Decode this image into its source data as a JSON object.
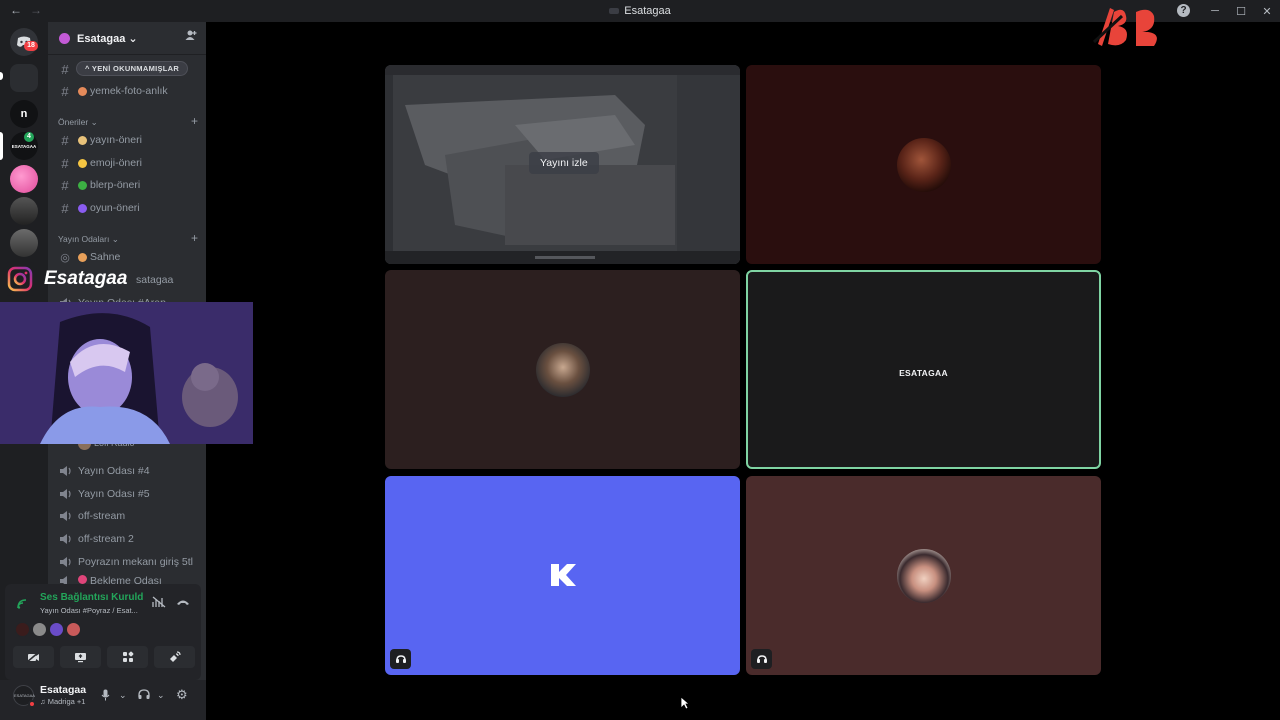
{
  "titlebar": {
    "back": "←",
    "forward": "→",
    "title": "Esatagaa",
    "help": "?",
    "minimize": "─",
    "maximize": "☐",
    "close": "✕"
  },
  "rail": {
    "dm_badge": "18",
    "server_n": "n",
    "server_esatagaa": "ESATAGAA",
    "server_esatagaa_badge": "4"
  },
  "server": {
    "name": "Esatagaa ⌄"
  },
  "channels": {
    "unread_pill": "^  YENİ OKUNMAMIŞLAR",
    "yemek": "yemek-foto-anlık",
    "cat_oneriler": "Öneriler ⌄",
    "yayin_oneri": "yayın-öneri",
    "emoji_oneri": "emoji-öneri",
    "blerp_oneri": "blerp-öneri",
    "oyun_oneri": "oyun-öneri",
    "cat_yayin": "Yayın Odaları ⌄",
    "sahne": "Sahne",
    "partial_user": "satagaa",
    "partial_room": "Yayın Odası #Arap",
    "lofi": "Lofi Radio",
    "yayin4": "Yayın Odası #4",
    "yayin5": "Yayın Odası #5",
    "offstream": "off-stream",
    "offstream2": "off-stream 2",
    "poyraz": "Poyrazın mekanı giriş 5tl",
    "bekleme": "Bekleme Odası"
  },
  "voice": {
    "status": "Ses Bağlantısı Kuruldu",
    "room": "Yayın Odası #Poyraz / Esat..."
  },
  "user": {
    "name": "Esatagaa",
    "status": "♫ Madriga +1",
    "avatar_text": "ESATAGAA"
  },
  "stream": {
    "watch_label": "Yayını izle",
    "tile_label": "ESATAGAA"
  },
  "overlay": {
    "instagram_handle": "Esatagaa"
  },
  "colors": {
    "accent_green": "#23a55a",
    "blurple": "#5865f2",
    "speaking_border": "#7fd4a3"
  }
}
